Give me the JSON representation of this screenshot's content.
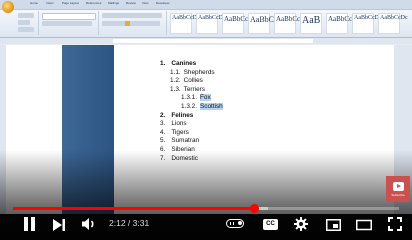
{
  "document": {
    "outline": [
      {
        "num": "1.",
        "text": "Canines",
        "bold": true
      },
      {
        "num": "1.1.",
        "text": "Shepherds"
      },
      {
        "num": "1.2.",
        "text": "Collies"
      },
      {
        "num": "1.3.",
        "text": "Terriers"
      },
      {
        "num": "1.3.1.",
        "text": "Fox",
        "selected": true
      },
      {
        "num": "1.3.2.",
        "text": "Scottish",
        "selected": true
      },
      {
        "num": "2.",
        "text": "Felines",
        "bold": true
      },
      {
        "num": "3.",
        "text": "Lions"
      },
      {
        "num": "4.",
        "text": "Tigers"
      },
      {
        "num": "5.",
        "text": "Sumatran"
      },
      {
        "num": "6.",
        "text": "Siberian"
      },
      {
        "num": "7.",
        "text": "Domestic"
      }
    ]
  },
  "ribbon": {
    "styles": [
      "AaBbCcDc",
      "AaBbCcDc",
      "AaBbCc",
      "AaBbC",
      "AaBbCc",
      "AaB",
      "AaBbCc",
      "AaBbCcDc",
      "AaBbCcDc"
    ]
  },
  "card": {
    "label": "Subscribe"
  },
  "player": {
    "current_time": "2:12",
    "duration": "3:31",
    "time_display": "2:12 / 3:31",
    "cc_label": "CC",
    "progress_played": 0.6256,
    "progress_buffered": 0.66,
    "accent_color": "#ff0000"
  }
}
